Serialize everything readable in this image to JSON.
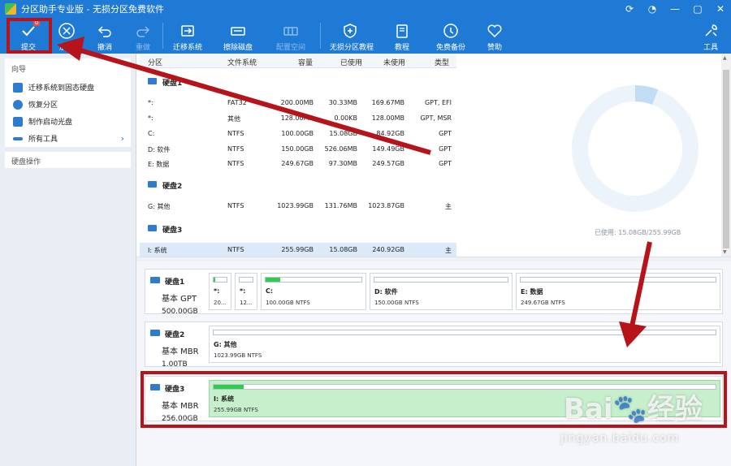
{
  "window": {
    "title": "分区助手专业版 - 无损分区免费软件",
    "controls": [
      "⟳",
      "◔",
      "—",
      "▢",
      "✕"
    ]
  },
  "toolbar": {
    "badge": "0",
    "items": [
      {
        "label": "提交",
        "icon": "check-icon"
      },
      {
        "label": "放弃",
        "icon": "close-circle-icon"
      },
      {
        "label": "撤消",
        "icon": "undo-icon"
      },
      {
        "label": "重做",
        "icon": "redo-icon"
      },
      {
        "label": "迁移系统",
        "icon": "migrate-icon"
      },
      {
        "label": "擦除磁盘",
        "icon": "wipe-disk-icon"
      },
      {
        "label": "配置空间",
        "icon": "config-space-icon"
      },
      {
        "label": "无损分区教程",
        "icon": "shield-icon"
      },
      {
        "label": "教程",
        "icon": "book-icon"
      },
      {
        "label": "免费备份",
        "icon": "backup-icon"
      },
      {
        "label": "赞助",
        "icon": "heart-icon"
      },
      {
        "label": "工具",
        "icon": "tools-icon"
      }
    ]
  },
  "sidebar": {
    "wizard_header": "向导",
    "items": [
      {
        "label": "迁移系统到固态硬盘"
      },
      {
        "label": "恢复分区"
      },
      {
        "label": "制作启动光盘"
      },
      {
        "label": "所有工具"
      }
    ],
    "disk_ops_header": "硬盘操作"
  },
  "table": {
    "columns": [
      "分区",
      "文件系统",
      "容量",
      "已使用",
      "未使用",
      "类型"
    ],
    "expand": "»",
    "disks": [
      {
        "name": "硬盘1",
        "partitions": [
          {
            "name": "*:",
            "fs": "FAT32",
            "cap": "200.00MB",
            "used": "30.33MB",
            "free": "169.67MB",
            "type": "GPT, EFI"
          },
          {
            "name": "*:",
            "fs": "其他",
            "cap": "128.00MB",
            "used": "0.00KB",
            "free": "128.00MB",
            "type": "GPT, MSR"
          },
          {
            "name": "C:",
            "fs": "NTFS",
            "cap": "100.00GB",
            "used": "15.08GB",
            "free": "84.92GB",
            "type": "GPT"
          },
          {
            "name": "D: 软件",
            "fs": "NTFS",
            "cap": "150.00GB",
            "used": "526.06MB",
            "free": "149.49GB",
            "type": "GPT"
          },
          {
            "name": "E: 数据",
            "fs": "NTFS",
            "cap": "249.67GB",
            "used": "97.30MB",
            "free": "249.57GB",
            "type": "GPT"
          }
        ]
      },
      {
        "name": "硬盘2",
        "partitions": [
          {
            "name": "G: 其他",
            "fs": "NTFS",
            "cap": "1023.99GB",
            "used": "131.76MB",
            "free": "1023.87GB",
            "type": "主"
          }
        ]
      },
      {
        "name": "硬盘3",
        "partitions": [
          {
            "name": "I: 系统",
            "fs": "NTFS",
            "cap": "255.99GB",
            "used": "15.08GB",
            "free": "240.92GB",
            "type": "主"
          }
        ]
      }
    ]
  },
  "donut": {
    "used_label": "已使用: 15.08GB/255.99GB",
    "used_fraction": 0.059,
    "colors": {
      "ring": "#edf3fb",
      "used": "#c3dcf6"
    }
  },
  "diskmap": {
    "disks": [
      {
        "name": "硬盘1",
        "type": "基本 GPT",
        "size": "500.00GB",
        "partitions": [
          {
            "name": "*:",
            "desc": "20...",
            "fill": 0.15
          },
          {
            "name": "*:",
            "desc": "12...",
            "fill": 0.0
          },
          {
            "name": "C:",
            "desc": "100.00GB NTFS",
            "fill": 0.15
          },
          {
            "name": "D: 软件",
            "desc": "150.00GB NTFS",
            "fill": 0.0
          },
          {
            "name": "E: 数据",
            "desc": "249.67GB NTFS",
            "fill": 0.0
          }
        ]
      },
      {
        "name": "硬盘2",
        "type": "基本 MBR",
        "size": "1.00TB",
        "partitions": [
          {
            "name": "G: 其他",
            "desc": "1023.99GB NTFS",
            "fill": 0.0
          }
        ]
      },
      {
        "name": "硬盘3",
        "type": "基本 MBR",
        "size": "256.00GB",
        "partitions": [
          {
            "name": "I: 系统",
            "desc": "255.99GB NTFS",
            "fill": 0.06
          }
        ]
      }
    ]
  },
  "watermark": {
    "brand": "Bai🐾经验",
    "url": "jingyan.baidu.com"
  },
  "colors": {
    "accent": "#1f7ad6",
    "highlight": "#b7131a",
    "selected_partition": "#c6f0cc",
    "usage_fill": "#2ecc4b"
  }
}
